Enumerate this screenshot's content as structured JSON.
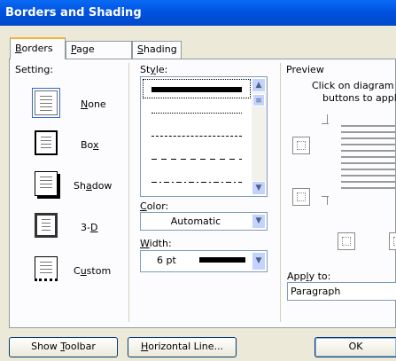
{
  "window": {
    "title": "Borders and Shading"
  },
  "tabs": [
    {
      "label": "Borders",
      "mn": "B",
      "rest": "orders"
    },
    {
      "label": "Page Border",
      "mn": "P",
      "rest": "age Border"
    },
    {
      "label": "Shading",
      "mn": "S",
      "rest": "hading"
    }
  ],
  "setting": {
    "label": "Setting:",
    "options": [
      {
        "pre": "",
        "mn": "N",
        "post": "one"
      },
      {
        "pre": "Bo",
        "mn": "x",
        "post": ""
      },
      {
        "pre": "Sh",
        "mn": "a",
        "post": "dow"
      },
      {
        "pre": "3-",
        "mn": "D",
        "post": ""
      },
      {
        "pre": "C",
        "mn": "u",
        "post": "stom"
      }
    ]
  },
  "style": {
    "label_pre": "St",
    "label_mn": "y",
    "label_post": "le:"
  },
  "color": {
    "label_pre": "",
    "label_mn": "C",
    "label_post": "olor:",
    "value": "Automatic"
  },
  "width": {
    "label_pre": "",
    "label_mn": "W",
    "label_post": "idth:",
    "value": "6 pt"
  },
  "preview": {
    "label": "Preview",
    "hint_line1": "Click on diagram bel",
    "hint_line2": "buttons to apply"
  },
  "apply_to": {
    "label_pre": "App",
    "label_mn": "l",
    "label_post": "y to:",
    "value": "Paragraph"
  },
  "buttons": {
    "show_toolbar_pre": "Show ",
    "show_toolbar_mn": "T",
    "show_toolbar_post": "oolbar",
    "horizontal_line_pre": "",
    "horizontal_line_mn": "H",
    "horizontal_line_post": "orizontal Line...",
    "ok": "OK"
  },
  "colors": {
    "titlebar": "#0054e3",
    "tab_highlight": "#f7b33b",
    "dialog_bg": "#ece9d8"
  }
}
